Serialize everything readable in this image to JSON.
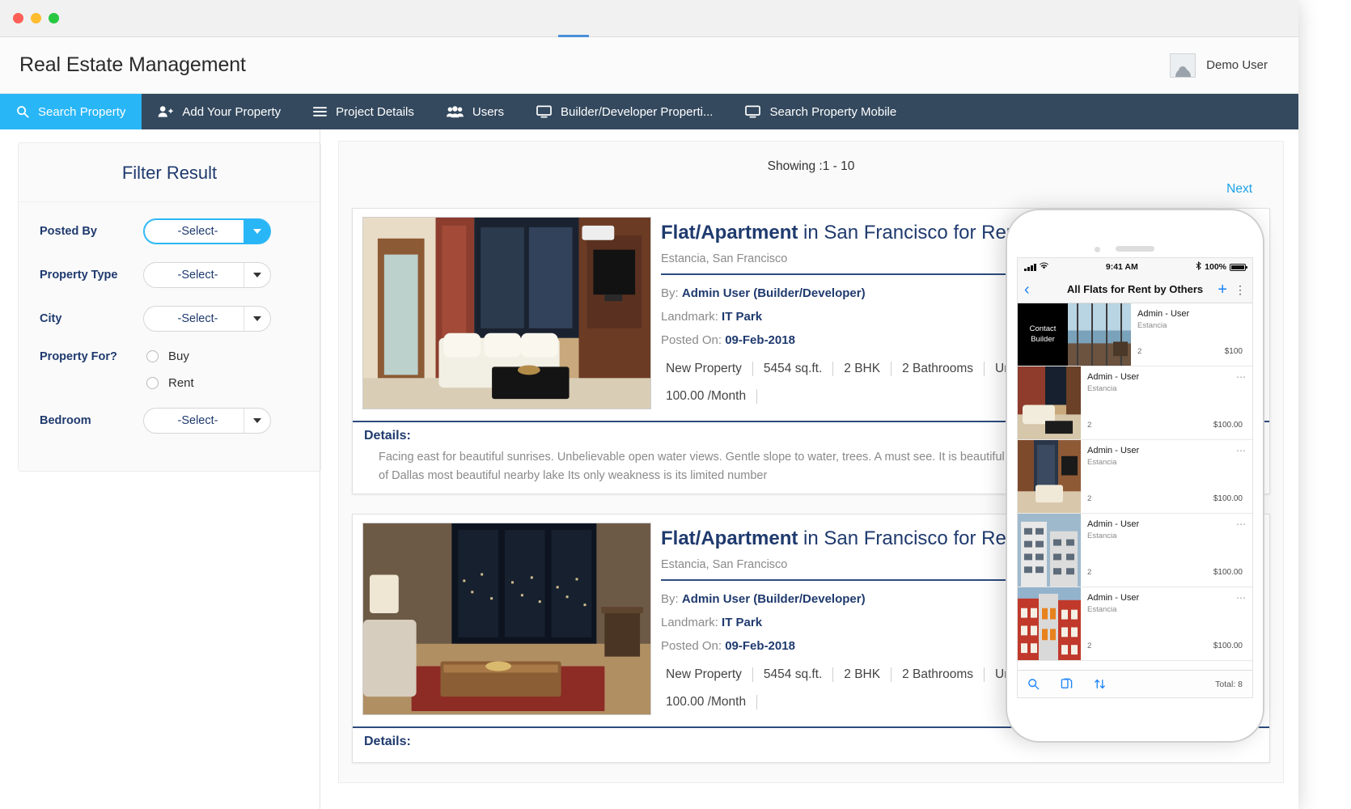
{
  "window": {
    "traffic_lights": [
      "close",
      "minimize",
      "maximize"
    ]
  },
  "header": {
    "title": "Real Estate Management",
    "user_name": "Demo User"
  },
  "navbar": {
    "items": [
      {
        "label": "Search Property",
        "icon": "search-icon",
        "active": true
      },
      {
        "label": "Add Your Property",
        "icon": "user-plus-icon",
        "active": false
      },
      {
        "label": "Project Details",
        "icon": "list-icon",
        "active": false
      },
      {
        "label": "Users",
        "icon": "users-icon",
        "active": false
      },
      {
        "label": "Builder/Developer Properti...",
        "icon": "monitor-icon",
        "active": false
      },
      {
        "label": "Search Property Mobile",
        "icon": "monitor-icon",
        "active": false
      }
    ]
  },
  "filter": {
    "title": "Filter Result",
    "fields": [
      {
        "label": "Posted By",
        "value": "-Select-",
        "focused": true
      },
      {
        "label": "Property Type",
        "value": "-Select-",
        "focused": false
      },
      {
        "label": "City",
        "value": "-Select-",
        "focused": false
      }
    ],
    "property_for": {
      "label": "Property For?",
      "options": [
        {
          "label": "Buy",
          "selected": false
        },
        {
          "label": "Rent",
          "selected": false
        }
      ]
    },
    "bedroom": {
      "label": "Bedroom",
      "value": "-Select-",
      "focused": false
    }
  },
  "results": {
    "showing": "Showing :1 - 10",
    "next_label": "Next",
    "listings": [
      {
        "title_bold": "Flat/Apartment",
        "title_rest": " in San Francisco for Rent",
        "location": "Estancia, San Francisco",
        "by_label": "By:",
        "by_value": "Admin User (Builder/Developer)",
        "landmark_label": "Landmark:",
        "landmark_value": "IT Park",
        "posted_label": "Posted On:",
        "posted_value": "09-Feb-2018",
        "specs": [
          "New Property",
          "5454 sq.ft.",
          "2 BHK",
          "2 Bathrooms",
          "Unfurnished"
        ],
        "price": "100.00 /Month",
        "details_label": "Details:",
        "details_text": "Facing east for beautiful sunrises. Unbelievable open water views. Gentle slope to water, trees. A must see. It is beautiful, meadows, and is gently rolling to the shoreline of Dallas most beautiful nearby lake Its only weakness is its limited number"
      },
      {
        "title_bold": "Flat/Apartment",
        "title_rest": " in San Francisco for Rent",
        "location": "Estancia, San Francisco",
        "by_label": "By:",
        "by_value": "Admin User (Builder/Developer)",
        "landmark_label": "Landmark:",
        "landmark_value": "IT Park",
        "posted_label": "Posted On:",
        "posted_value": "09-Feb-2018",
        "specs": [
          "New Property",
          "5454 sq.ft.",
          "2 BHK",
          "2 Bathrooms",
          "Unfurnished"
        ],
        "price": "100.00 /Month",
        "details_label": "Details:",
        "details_text": ""
      }
    ]
  },
  "phone": {
    "status": {
      "time": "9:41 AM",
      "battery": "100%",
      "bluetooth": "bluetooth-icon"
    },
    "nav": {
      "back": "back-chevron-icon",
      "title": "All Flats for Rent by Others",
      "add": "plus-icon",
      "menu": "more-vertical-icon"
    },
    "rows": [
      {
        "contact_label": "Contact\nBuilder",
        "name": "Admin - User",
        "place": "Estancia",
        "bedrooms": "2",
        "price": "$100",
        "has_more": false,
        "thumb": "seaview"
      },
      {
        "name": "Admin - User",
        "place": "Estancia",
        "bedrooms": "2",
        "price": "$100.00",
        "has_more": true,
        "thumb": "livingroom"
      },
      {
        "name": "Admin - User",
        "place": "Estancia",
        "bedrooms": "2",
        "price": "$100.00",
        "has_more": true,
        "thumb": "interior"
      },
      {
        "name": "Admin - User",
        "place": "Estancia",
        "bedrooms": "2",
        "price": "$100.00",
        "has_more": true,
        "thumb": "building"
      },
      {
        "name": "Admin - User",
        "place": "Estancia",
        "bedrooms": "2",
        "price": "$100.00",
        "has_more": true,
        "thumb": "redbuilding"
      }
    ],
    "toolbar": {
      "search": "search-icon",
      "copy": "copy-icon",
      "sort": "sort-icon",
      "total": "Total: 8"
    }
  },
  "colors": {
    "navbar_bg": "#34495e",
    "accent": "#29b6f6",
    "title_blue": "#1f3a6e",
    "link_blue": "#1aa3e8",
    "ios_blue": "#1a82f7"
  }
}
